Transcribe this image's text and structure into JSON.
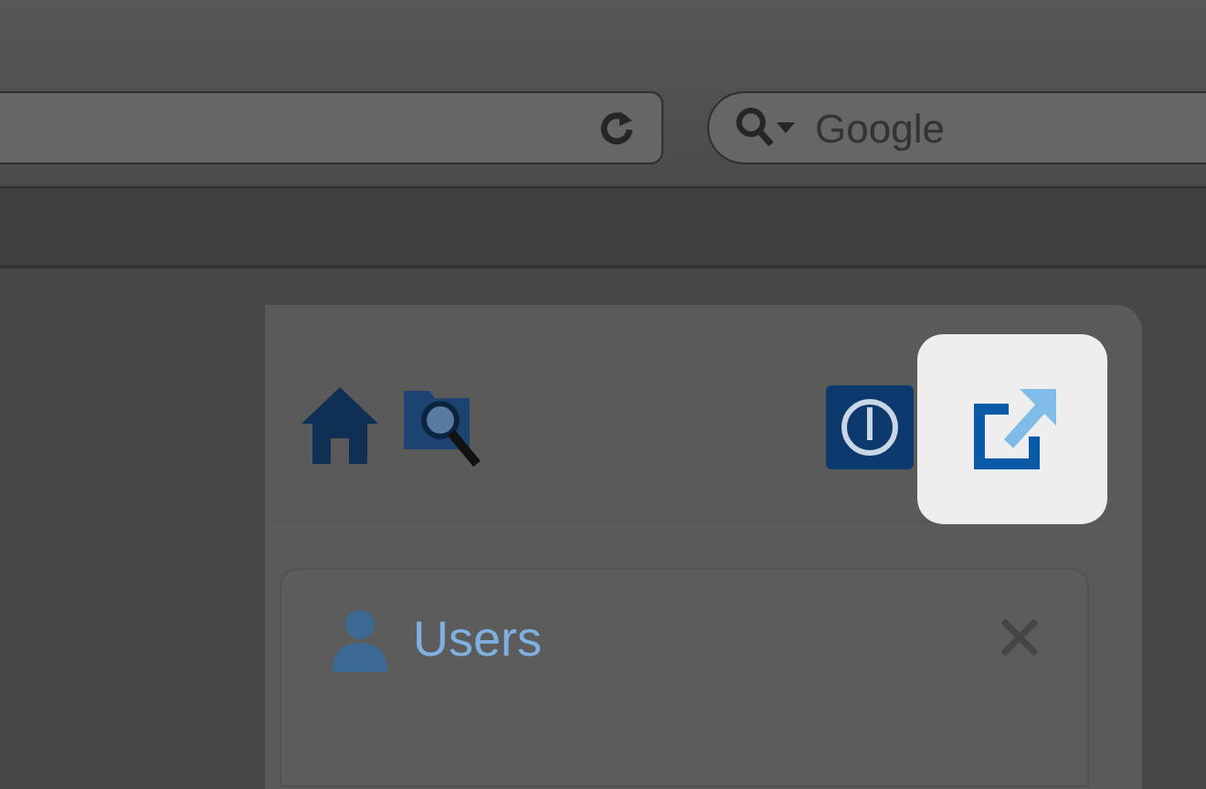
{
  "browser": {
    "search": {
      "placeholder": "Google"
    }
  },
  "toolbar": {
    "left_icons": [
      {
        "kind": "home",
        "highlighted": false
      },
      {
        "kind": "folder-search",
        "highlighted": false
      }
    ],
    "right_icons": [
      {
        "kind": "power",
        "highlighted": false
      },
      {
        "kind": "external-link",
        "highlighted": true
      }
    ]
  },
  "panel": {
    "title": "Users"
  }
}
